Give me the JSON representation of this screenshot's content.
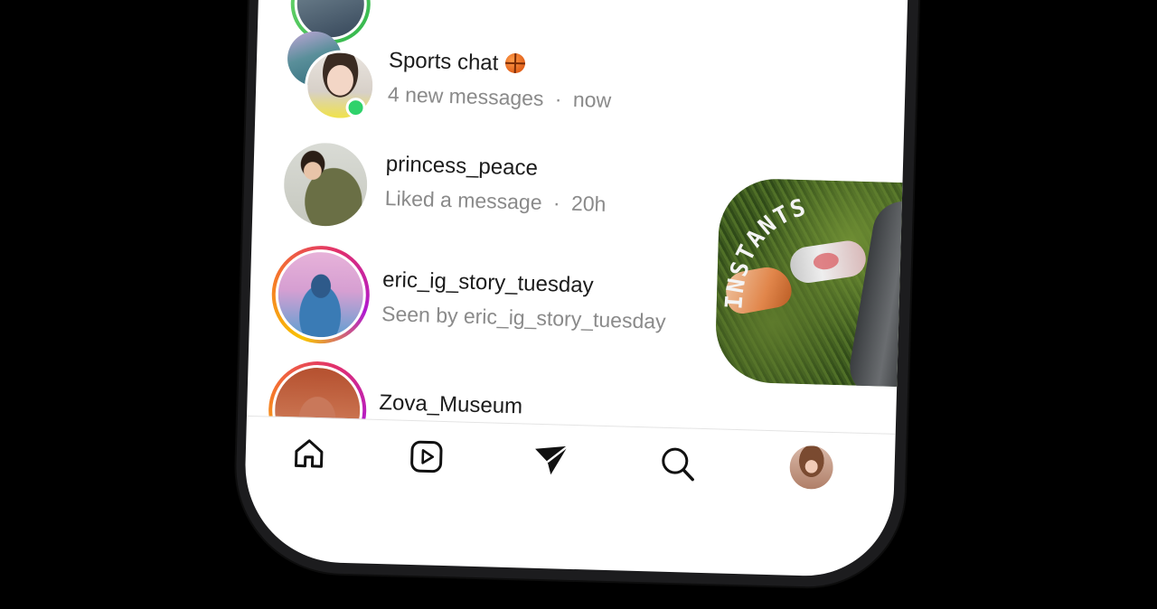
{
  "chats": [
    {
      "name": "Sports chat",
      "emoji_icon": "basketball-icon",
      "subtitle": "4 new messages",
      "separator": "·",
      "time": "now",
      "online": true,
      "online_color": "#2fd26b"
    },
    {
      "name": "princess_peace",
      "subtitle": "Liked a message",
      "separator": "·",
      "time": "20h"
    },
    {
      "name": "eric_ig_story_tuesday",
      "subtitle": "Seen by eric_ig_story_tuesday",
      "has_story_ring": true
    },
    {
      "name": "Zova_Museum",
      "has_story_ring": true
    }
  ],
  "instants": {
    "label": "INSTANTS"
  },
  "nav": [
    {
      "icon": "home-icon"
    },
    {
      "icon": "reels-icon"
    },
    {
      "icon": "direct-messages-icon",
      "active": true
    },
    {
      "icon": "search-icon"
    },
    {
      "icon": "profile-avatar"
    }
  ],
  "colors": {
    "story_ring": [
      "#f9c400",
      "#f5762c",
      "#e1306c",
      "#b01ad1"
    ],
    "text_primary": "#1b1b1b",
    "text_secondary": "#8a8a8a"
  }
}
